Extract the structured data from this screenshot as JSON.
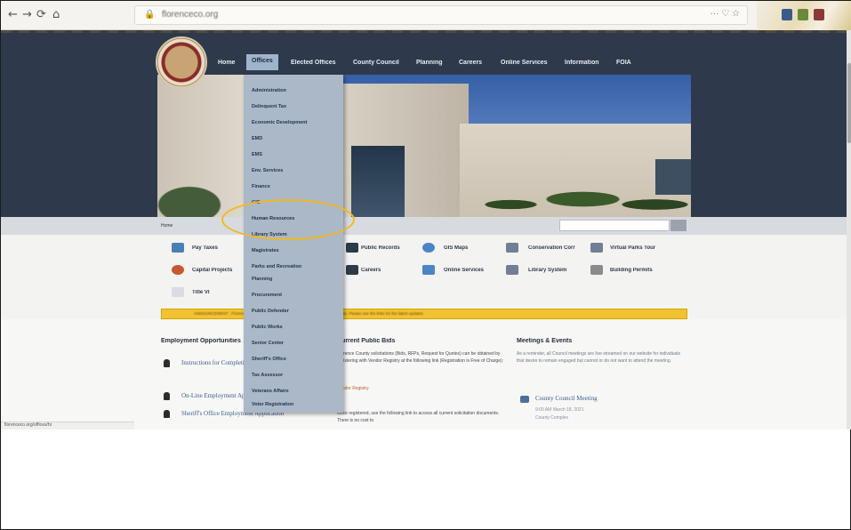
{
  "browser": {
    "url": "florenceco.org",
    "nav": {
      "back": "←",
      "forward": "→",
      "reload": "⟳",
      "home": "⌂"
    },
    "url_icons": "··· ♡ ☆"
  },
  "site": {
    "menu": [
      "Home",
      "Offices",
      "Elected Offices",
      "County Council",
      "Planning",
      "Careers",
      "Online Services",
      "Information",
      "FOIA"
    ],
    "active_menu": "Offices",
    "breadcrumb": "Home",
    "search_placeholder": "",
    "dropdown_items": [
      "Administration",
      "Delinquent Tax",
      "Economic Development",
      "EMD",
      "EMS",
      "Env. Services",
      "Finance",
      "GIS",
      "Human Resources",
      "Library System",
      "Magistrates",
      "Parks and Recreation",
      "Planning",
      "Procurement",
      "Public Defender",
      "Public Works",
      "Senior Center",
      "Sheriff's Office",
      "Tax Assessor",
      "Veterans Affairs",
      "Voter Registration"
    ],
    "highlighted_item": "Human Resources",
    "quick_links": {
      "col1": [
        "Pay Taxes",
        "Capital Projects",
        "Title VI"
      ],
      "col2": [
        "Public Records",
        "Careers"
      ],
      "col3": [
        "GIS Maps",
        "Online Services"
      ],
      "col4": [
        "Conservation Corr",
        "Library System"
      ],
      "col5": [
        "Virtual Parks Tour",
        "Building Permits"
      ]
    },
    "alert": "ANNOUNCEMENT · Florence County Covid-19 information is available on the website. Please use the links for the latest updates.",
    "columns": {
      "employment": {
        "title": "Employment Opportunities",
        "links": [
          "Instructions for Completing Application",
          "On-Line Employment Application",
          "Sheriff's Office Employment Application"
        ]
      },
      "bids": {
        "title": "Current Public Bids",
        "text": "Florence County solicitations (Bids, RFPs, Request for Quotes) can be obtained by registering with Vendor Registry at the following link (Registration is Free of Charge):",
        "link": "Vendor Registry",
        "text2": "Once registered, use the following link to access all current solicitation documents. There is no cost to"
      },
      "meetings": {
        "title": "Meetings & Events",
        "text": "As a reminder, all Council meetings are live streamed on our website for individuals that desire to remain engaged but cannot or do not want to attend the meeting.",
        "event_title": "County Council Meeting",
        "event_time": "9:00 AM March 18, 2021",
        "event_location": "County Complex"
      }
    },
    "status_url": "florenceco.org/offices/hr"
  }
}
